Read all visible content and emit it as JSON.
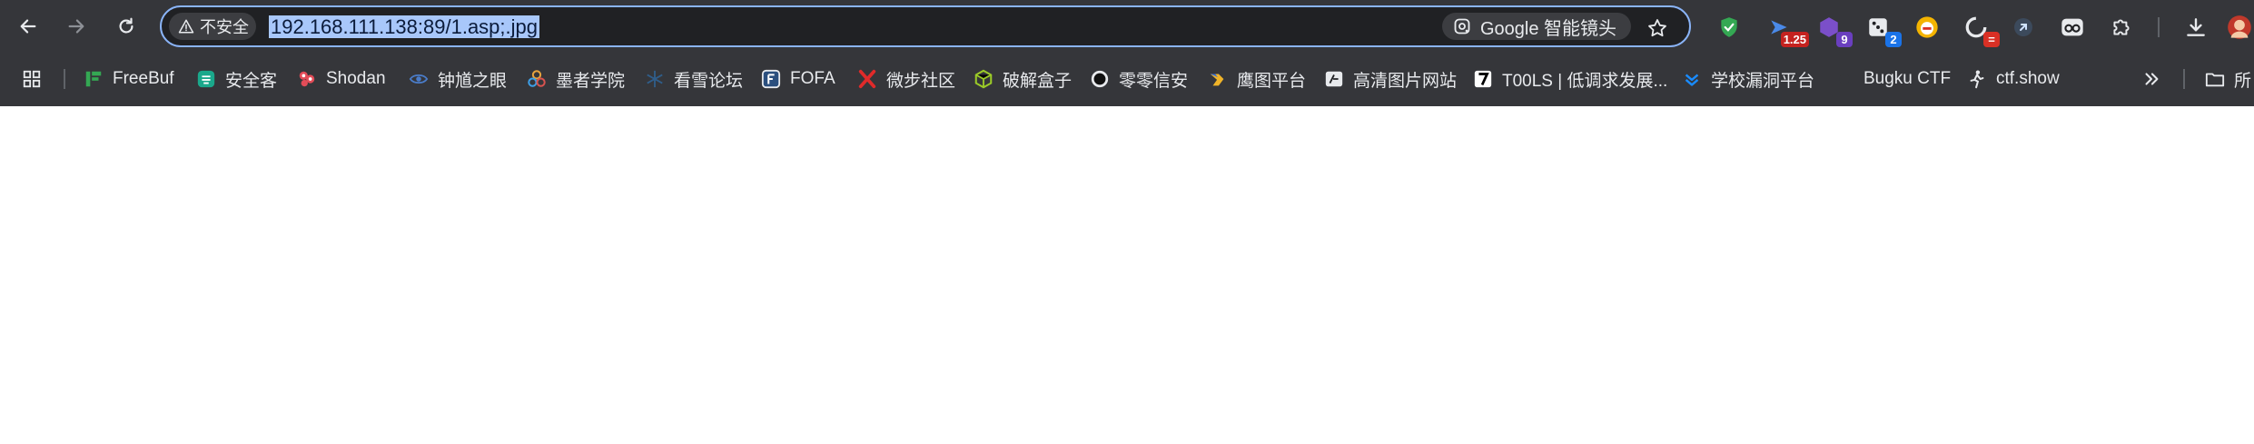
{
  "toolbar": {
    "security_label": "不安全",
    "url": "192.168.111.138:89/1.asp;.jpg",
    "lens_label": "Google 智能镜头"
  },
  "extensions": {
    "speed_badge": "1.25",
    "ext_badge_9": "9",
    "ext_badge_2": "2",
    "ext_badge_minus": "="
  },
  "bookmarks": {
    "items": [
      {
        "label": "FreeBuf"
      },
      {
        "label": "安全客"
      },
      {
        "label": "Shodan"
      },
      {
        "label": "钟馗之眼"
      },
      {
        "label": "墨者学院"
      },
      {
        "label": "看雪论坛"
      },
      {
        "label": "FOFA"
      },
      {
        "label": "微步社区"
      },
      {
        "label": "破解盒子"
      },
      {
        "label": "零零信安"
      },
      {
        "label": "鹰图平台"
      },
      {
        "label": "高清图片网站"
      },
      {
        "label": "T00LS | 低调求发展..."
      },
      {
        "label": "学校漏洞平台"
      },
      {
        "label": "Bugku CTF"
      },
      {
        "label": "ctf.show"
      }
    ],
    "overflow_folder_label": "所"
  },
  "colors": {
    "chrome_bg": "#35363a",
    "omnibox_bg": "#202124",
    "focus_ring": "#8ab4f8",
    "text": "#e8eaed"
  }
}
